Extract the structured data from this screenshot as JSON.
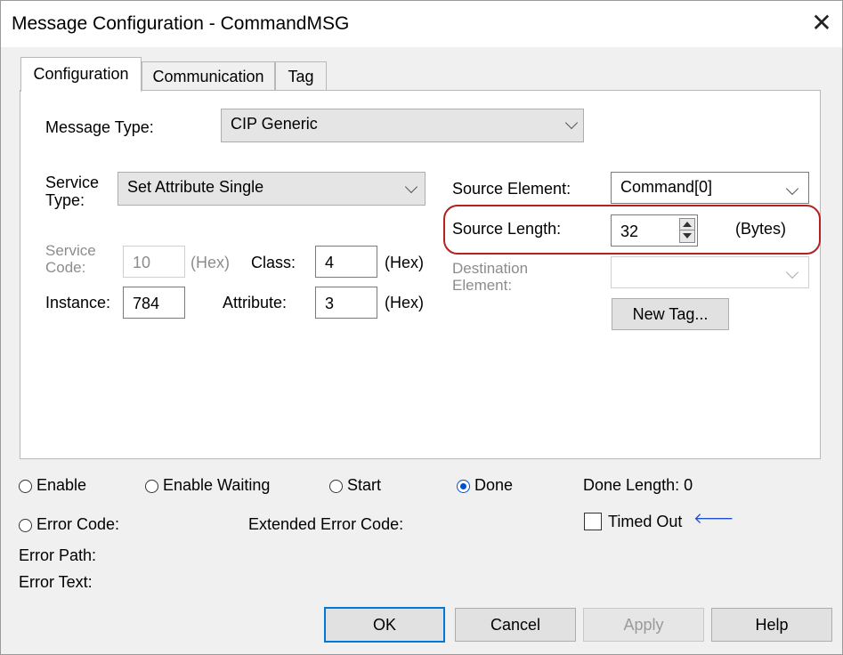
{
  "window": {
    "title": "Message Configuration - CommandMSG",
    "close_glyph": "✕"
  },
  "tabs": [
    {
      "label": "Configuration",
      "active": true
    },
    {
      "label": "Communication",
      "active": false
    },
    {
      "label": "Tag",
      "active": false
    }
  ],
  "config": {
    "message_type_label": "Message Type:",
    "message_type_value": "CIP Generic",
    "service_type_label_1": "Service",
    "service_type_label_2": "Type:",
    "service_type_value": "Set Attribute Single",
    "service_code_label_1": "Service",
    "service_code_label_2": "Code:",
    "service_code_value": "10",
    "service_code_unit": "(Hex)",
    "class_label": "Class:",
    "class_value": "4",
    "class_unit": "(Hex)",
    "instance_label": "Instance:",
    "instance_value": "784",
    "attribute_label": "Attribute:",
    "attribute_value": "3",
    "attribute_unit": "(Hex)",
    "source_element_label": "Source Element:",
    "source_element_value": "Command[0]",
    "source_length_label": "Source Length:",
    "source_length_value": "32",
    "source_length_unit": "(Bytes)",
    "destination_label_1": "Destination",
    "destination_label_2": "Element:",
    "destination_value": "",
    "new_tag_label": "New Tag..."
  },
  "status": {
    "enable": "Enable",
    "enable_waiting": "Enable Waiting",
    "start": "Start",
    "done": "Done",
    "done_length": "Done Length: 0",
    "error_code": "Error Code:",
    "extended_error_code": "Extended Error Code:",
    "timed_out": "Timed Out",
    "timed_out_arrow": "🡐",
    "error_path": "Error Path:",
    "error_text": "Error Text:",
    "selected_radio": "done"
  },
  "buttons": {
    "ok": "OK",
    "cancel": "Cancel",
    "apply": "Apply",
    "help": "Help"
  },
  "colors": {
    "highlight": "#b22222",
    "accent": "#0078d7",
    "radio_checked": "#0050c8"
  }
}
